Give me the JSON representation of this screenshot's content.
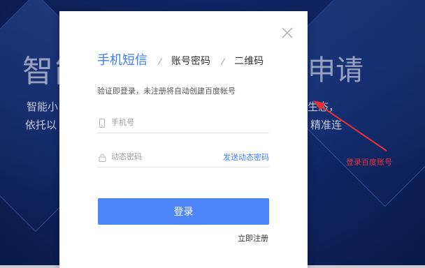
{
  "background": {
    "headline_left": "智能",
    "headline_right": "申请",
    "line1_left": "智能小",
    "line1_right": "生态，",
    "line2_left": "依托以",
    "line2_right": "精准连"
  },
  "modal": {
    "tabs": [
      {
        "label": "手机短信",
        "active": true
      },
      {
        "label": "账号密码",
        "active": false
      },
      {
        "label": "二维码",
        "active": false
      }
    ],
    "tab_separator": "/",
    "notice": "验证即登录，未注册将自动创建百度帐号",
    "phone_placeholder": "手机号",
    "code_placeholder": "动态密码",
    "send_code_label": "发送动态密码",
    "login_label": "登录",
    "register_label": "立即注册"
  },
  "annotation": {
    "label": "登录百度账号",
    "color": "#e8323a"
  },
  "colors": {
    "accent": "#3b7cf7",
    "button": "#4d86f7"
  }
}
